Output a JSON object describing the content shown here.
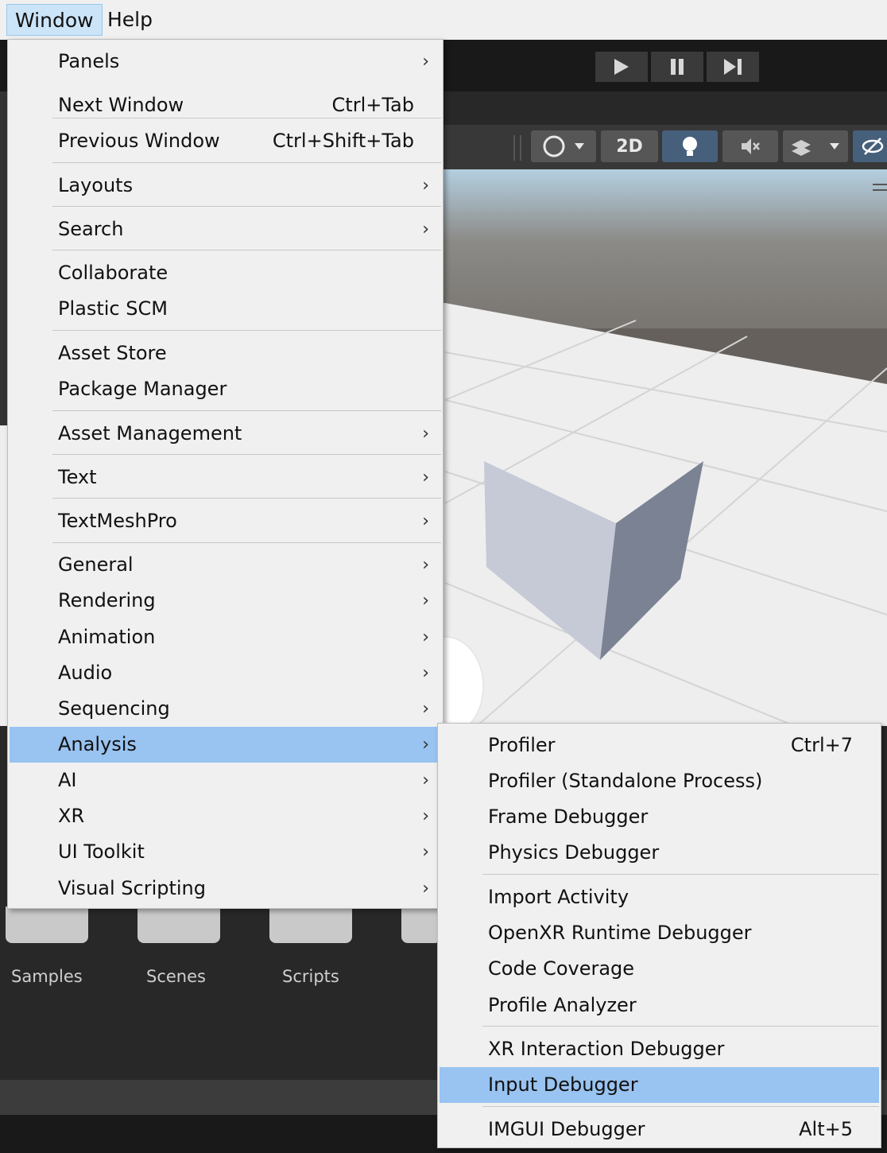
{
  "menubar": {
    "items": [
      "Window",
      "Help"
    ]
  },
  "playbar": {
    "play": "play-icon",
    "pause": "pause-icon",
    "step": "step-icon"
  },
  "scene_toolbar": {
    "mode_2d": "2D"
  },
  "window_menu": [
    {
      "label": "Panels",
      "submenu": true
    },
    {
      "label": "Next Window",
      "shortcut": "Ctrl+Tab"
    },
    {
      "label": "Previous Window",
      "shortcut": "Ctrl+Shift+Tab"
    },
    {
      "label": "Layouts",
      "submenu": true
    },
    {
      "label": "Search",
      "submenu": true
    },
    {
      "label": "Collaborate"
    },
    {
      "label": "Plastic SCM"
    },
    {
      "label": "Asset Store"
    },
    {
      "label": "Package Manager"
    },
    {
      "label": "Asset Management",
      "submenu": true
    },
    {
      "label": "Text",
      "submenu": true
    },
    {
      "label": "TextMeshPro",
      "submenu": true
    },
    {
      "label": "General",
      "submenu": true
    },
    {
      "label": "Rendering",
      "submenu": true
    },
    {
      "label": "Animation",
      "submenu": true
    },
    {
      "label": "Audio",
      "submenu": true
    },
    {
      "label": "Sequencing",
      "submenu": true
    },
    {
      "label": "Analysis",
      "submenu": true,
      "highlighted": true
    },
    {
      "label": "AI",
      "submenu": true
    },
    {
      "label": "XR",
      "submenu": true
    },
    {
      "label": "UI Toolkit",
      "submenu": true
    },
    {
      "label": "Visual Scripting",
      "submenu": true
    }
  ],
  "analysis_menu": [
    {
      "label": "Profiler",
      "shortcut": "Ctrl+7"
    },
    {
      "label": "Profiler (Standalone Process)"
    },
    {
      "label": "Frame Debugger"
    },
    {
      "label": "Physics Debugger"
    },
    {
      "label": "Import Activity"
    },
    {
      "label": "OpenXR Runtime Debugger"
    },
    {
      "label": "Code Coverage"
    },
    {
      "label": "Profile Analyzer"
    },
    {
      "label": "XR Interaction Debugger"
    },
    {
      "label": "Input Debugger",
      "highlighted": true
    },
    {
      "label": "IMGUI Debugger",
      "shortcut": "Alt+5"
    }
  ],
  "project_folders": [
    "Samples",
    "Scenes",
    "Scripts"
  ]
}
